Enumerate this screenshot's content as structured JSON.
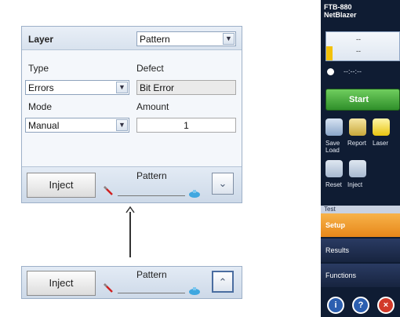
{
  "panel": {
    "layer_label": "Layer",
    "layer_value": "Pattern",
    "type_label": "Type",
    "type_value": "Errors",
    "defect_label": "Defect",
    "defect_value": "Bit Error",
    "mode_label": "Mode",
    "mode_value": "Manual",
    "amount_label": "Amount",
    "amount_value": "1",
    "inject_label": "Inject",
    "pattern_label": "Pattern"
  },
  "collapsed_panel": {
    "inject_label": "Inject",
    "pattern_label": "Pattern"
  },
  "device": {
    "title_line1": "FTB-880",
    "title_line2": "NetBlazer",
    "gauge_line1": "--",
    "gauge_line2": "--",
    "timer_text": "--:--:--",
    "start_label": "Start",
    "tools": [
      {
        "label": "Save Load",
        "icon": "save-load-icon"
      },
      {
        "label": "Report",
        "icon": "report-icon"
      },
      {
        "label": "Laser",
        "icon": "laser-icon"
      },
      {
        "label": "Reset",
        "icon": "reset-icon"
      },
      {
        "label": "Inject",
        "icon": "inject-icon"
      }
    ],
    "menu_header": "Test",
    "menu_items": [
      "Setup",
      "Results",
      "Functions"
    ],
    "accent_active": "#f39c1f",
    "bottom_icons": [
      "info-icon",
      "help-icon",
      "close-icon"
    ]
  }
}
